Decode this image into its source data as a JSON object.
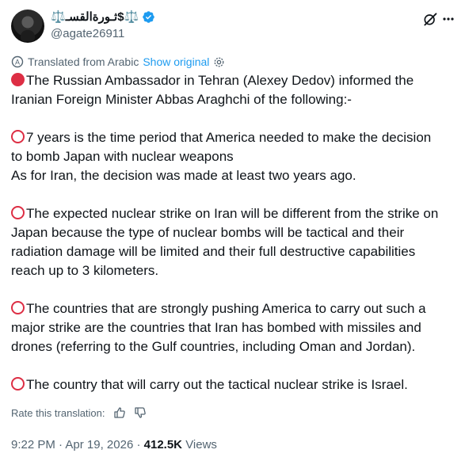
{
  "author": {
    "display_name": "⚖️ثـورةالقسـ$⚖️",
    "handle": "@agate26911"
  },
  "translation": {
    "label": "Translated from Arabic",
    "link": "Show original"
  },
  "body": {
    "paragraphs": [
      {
        "marker": "red-circle",
        "lines": [
          "The Russian Ambassador in Tehran (Alexey Dedov) informed the",
          "Iranian Foreign Minister Abbas Araghchi of the following:-"
        ]
      },
      {
        "marker": "hollow-red-circle",
        "lines": [
          "7 years is the time period that America needed to make the decision",
          "to bomb Japan with nuclear weapons",
          "As for Iran, the decision was made at least two years ago."
        ]
      },
      {
        "marker": "hollow-red-circle",
        "lines": [
          "The expected nuclear strike on Iran will be different from the strike on",
          "Japan because the type of nuclear bombs will be tactical and their",
          "radiation damage will be limited and their full destructive capabilities",
          "reach up to 3 kilometers."
        ]
      },
      {
        "marker": "hollow-red-circle",
        "lines": [
          "The countries that are strongly pushing America to carry out such a",
          "major strike are the countries that Iran has bombed with missiles and",
          "drones (referring to the Gulf countries, including Oman and Jordan)."
        ]
      },
      {
        "marker": "hollow-red-circle",
        "lines": [
          "The country that will carry out the tactical nuclear strike is Israel."
        ]
      }
    ]
  },
  "rate": {
    "label": "Rate this translation:"
  },
  "meta": {
    "time": "9:22 PM",
    "date": "Apr 19, 2026",
    "views_count": "412.5K",
    "views_label": "Views"
  },
  "colors": {
    "accent": "#1d9bf0",
    "marker": "#dd2e44",
    "muted": "#536471"
  }
}
